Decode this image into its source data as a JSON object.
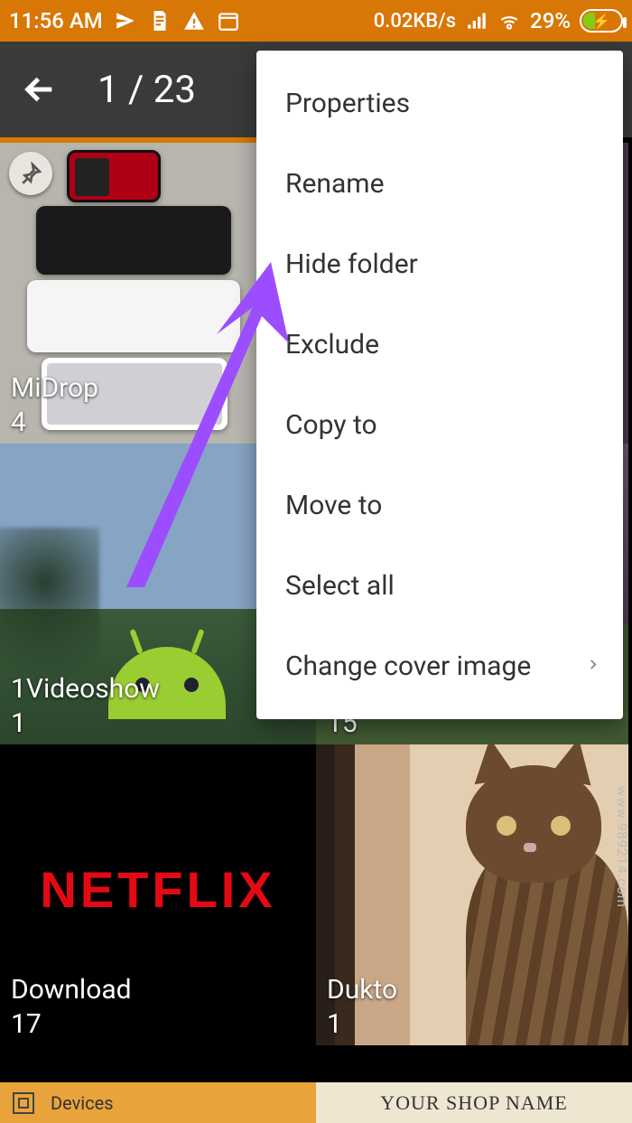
{
  "statusbar": {
    "time": "11:56 AM",
    "icons": [
      "send-icon",
      "document-icon",
      "warning-icon",
      "calendar-icon"
    ],
    "net_speed": "0.02KB/s",
    "signal_icon": "cell-signal-icon",
    "wifi_icon": "wifi-icon",
    "battery_pct": "29%",
    "battery_fill_pct": 29,
    "charging": true
  },
  "toolbar": {
    "back_icon": "back-arrow-icon",
    "title": "1 / 23"
  },
  "menu": {
    "items": [
      {
        "label": "Properties",
        "submenu": false
      },
      {
        "label": "Rename",
        "submenu": false
      },
      {
        "label": "Hide folder",
        "submenu": false
      },
      {
        "label": "Exclude",
        "submenu": false
      },
      {
        "label": "Copy to",
        "submenu": false
      },
      {
        "label": "Move to",
        "submenu": false
      },
      {
        "label": "Select all",
        "submenu": false
      },
      {
        "label": "Change cover image",
        "submenu": true
      }
    ]
  },
  "albums": {
    "t1": {
      "name": "MiDrop",
      "count": "4",
      "pinned": true
    },
    "t2": {
      "name": "1Videoshow",
      "count": "1"
    },
    "t3": {
      "name": "Download",
      "count": "17",
      "brand": "NETFLIX"
    },
    "t5": {
      "count": "15"
    },
    "t6": {
      "name": "Dukto",
      "count": "1"
    }
  },
  "annotation": {
    "arrow_target": "menu-item-hide-folder",
    "arrow_color": "#9b4dff"
  },
  "bottombar": {
    "left_label": "Devices",
    "right_label": "YOUR SHOP NAME"
  },
  "watermark": "www.989214.com"
}
